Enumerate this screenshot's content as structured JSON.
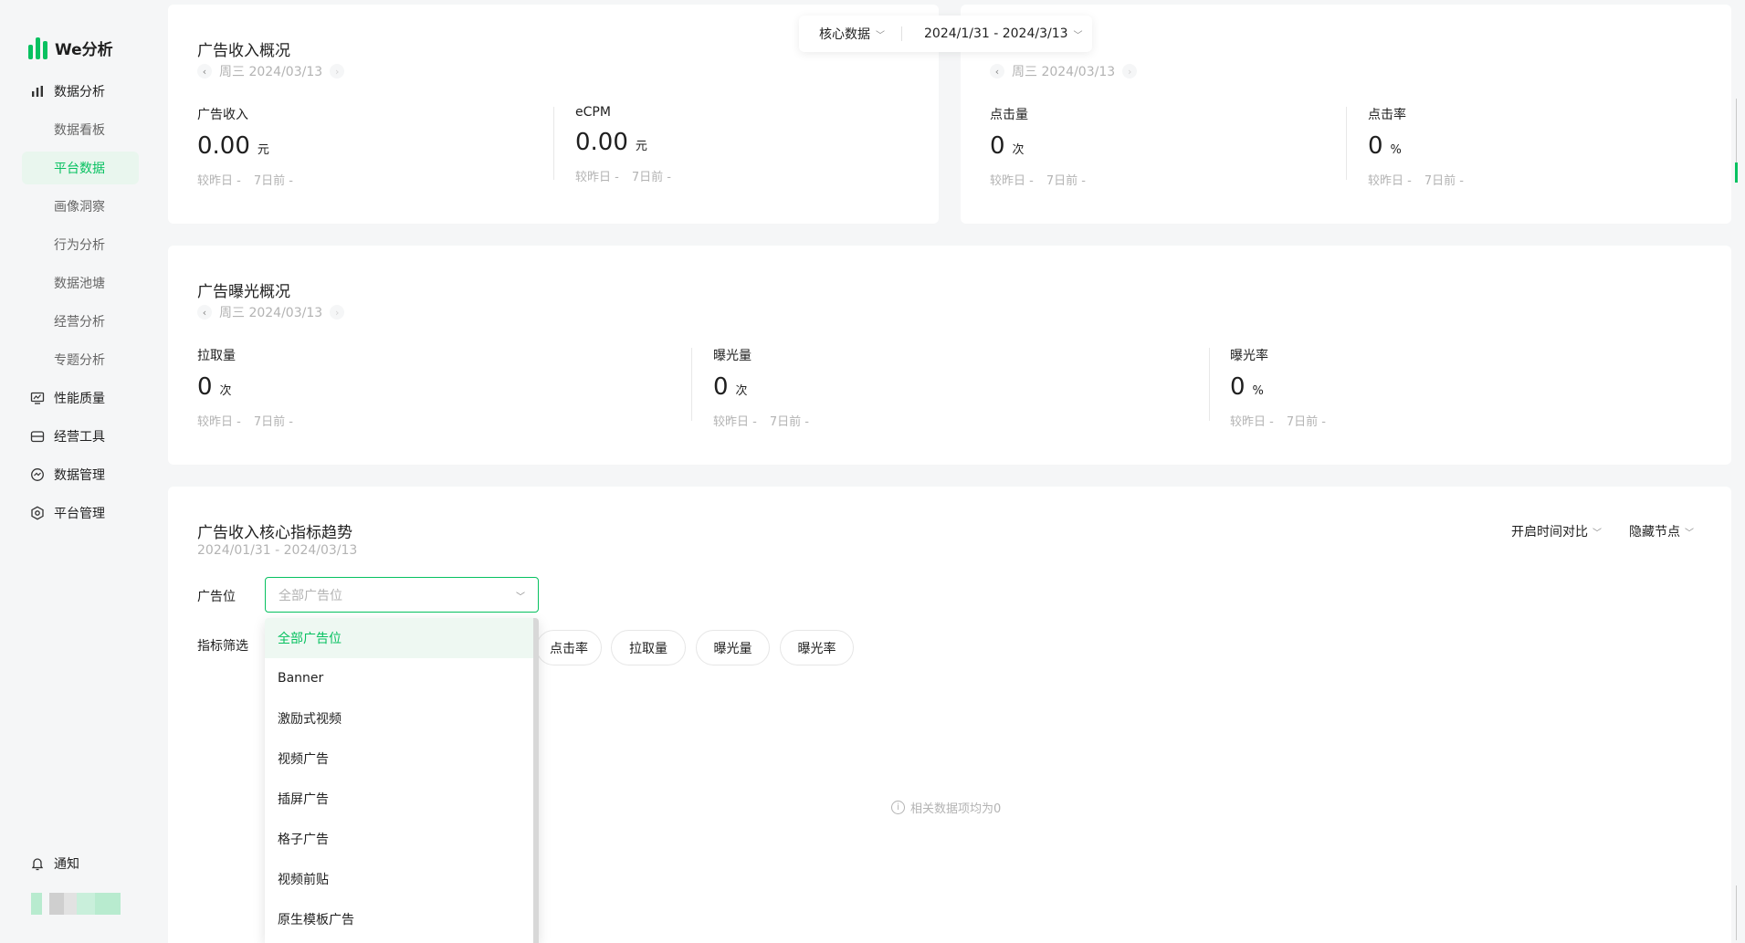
{
  "app": {
    "name": "We分析"
  },
  "sidebar": {
    "items": [
      {
        "label": "数据分析",
        "icon": "bar-chart-icon"
      },
      {
        "label": "数据看板"
      },
      {
        "label": "平台数据"
      },
      {
        "label": "画像洞察"
      },
      {
        "label": "行为分析"
      },
      {
        "label": "数据池塘"
      },
      {
        "label": "经营分析"
      },
      {
        "label": "专题分析"
      },
      {
        "label": "性能质量",
        "icon": "monitor-icon"
      },
      {
        "label": "经营工具",
        "icon": "toolbox-icon"
      },
      {
        "label": "数据管理",
        "icon": "data-manage-icon"
      },
      {
        "label": "平台管理",
        "icon": "settings-hex-icon"
      }
    ],
    "active_index": 2,
    "notify_label": "通知"
  },
  "filterbar": {
    "metric_select": "核心数据",
    "date_range": "2024/1/31 - 2024/3/13"
  },
  "income_card": {
    "title": "广告收入概况",
    "date": "周三 2024/03/13",
    "metrics": [
      {
        "label": "广告收入",
        "value": "0.00",
        "unit": "元",
        "cmp_day": "较昨日 -",
        "cmp_week": "7日前 -"
      },
      {
        "label": "eCPM",
        "value": "0.00",
        "unit": "元",
        "cmp_day": "较昨日 -",
        "cmp_week": "7日前 -"
      }
    ]
  },
  "click_card": {
    "date": "周三 2024/03/13",
    "metrics": [
      {
        "label": "点击量",
        "value": "0",
        "unit": "次",
        "cmp_day": "较昨日 -",
        "cmp_week": "7日前 -"
      },
      {
        "label": "点击率",
        "value": "0",
        "unit": "%",
        "cmp_day": "较昨日 -",
        "cmp_week": "7日前 -"
      }
    ]
  },
  "exposure_card": {
    "title": "广告曝光概况",
    "date": "周三 2024/03/13",
    "metrics": [
      {
        "label": "拉取量",
        "value": "0",
        "unit": "次",
        "cmp_day": "较昨日 -",
        "cmp_week": "7日前 -"
      },
      {
        "label": "曝光量",
        "value": "0",
        "unit": "次",
        "cmp_day": "较昨日 -",
        "cmp_week": "7日前 -"
      },
      {
        "label": "曝光率",
        "value": "0",
        "unit": "%",
        "cmp_day": "较昨日 -",
        "cmp_week": "7日前 -"
      }
    ]
  },
  "trend_card": {
    "title": "广告收入核心指标趋势",
    "range": "2024/01/31 - 2024/03/13",
    "time_compare": "开启时间对比",
    "hide_nodes": "隐藏节点",
    "ad_slot_label": "广告位",
    "ad_slot_placeholder": "全部广告位",
    "metric_filter_label": "指标筛选",
    "pills": [
      "点击率",
      "拉取量",
      "曝光量",
      "曝光率"
    ],
    "empty_text": "相关数据项均为0"
  },
  "dropdown": {
    "options": [
      "全部广告位",
      "Banner",
      "激励式视频",
      "视频广告",
      "插屏广告",
      "格子广告",
      "视频前贴",
      "原生模板广告"
    ],
    "selected_index": 0
  },
  "colors": {
    "accent": "#07c160",
    "accent_bg": "#e9f6ee"
  }
}
